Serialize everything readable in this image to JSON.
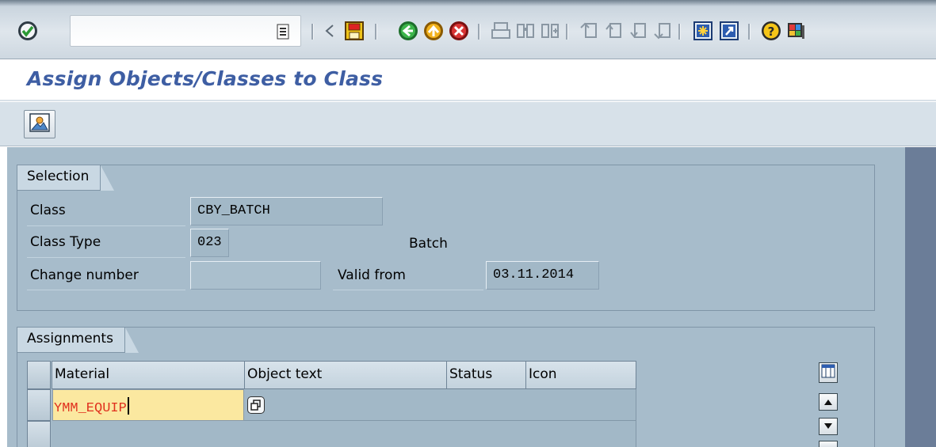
{
  "toolbar": {
    "command_value": "",
    "icons": [
      "enter-icon",
      "command-history-icon",
      "back-arrow-icon",
      "save-icon",
      "back-icon",
      "exit-icon",
      "cancel-icon",
      "print-icon",
      "find-icon",
      "find-next-icon",
      "first-page-icon",
      "previous-page-icon",
      "next-page-icon",
      "last-page-icon",
      "create-session-icon",
      "shortcut-icon",
      "help-icon",
      "layout-menu-icon"
    ]
  },
  "title": "Assign Objects/Classes to Class",
  "app_toolbar": {
    "icons": [
      "display-object-icon"
    ]
  },
  "selection": {
    "group_label": "Selection",
    "class_label": "Class",
    "class_value": "CBY_BATCH",
    "class_type_label": "Class Type",
    "class_type_value": "023",
    "class_type_text": "Batch",
    "change_number_label": "Change number",
    "change_number_value": "",
    "valid_from_label": "Valid from",
    "valid_from_value": "03.11.2014"
  },
  "assignments": {
    "group_label": "Assignments",
    "columns": [
      "Material",
      "Object text",
      "Status",
      "Icon"
    ],
    "rows": [
      {
        "material": "YMM_EQUIP",
        "object_text": "",
        "status": "",
        "icon": ""
      },
      {
        "material": "",
        "object_text": "",
        "status": "",
        "icon": ""
      }
    ]
  },
  "colors": {
    "title": "#3e5ea3",
    "background": "#a7bccb",
    "active_field": "#fbe8a0",
    "input_text_active": "#e0301e"
  }
}
